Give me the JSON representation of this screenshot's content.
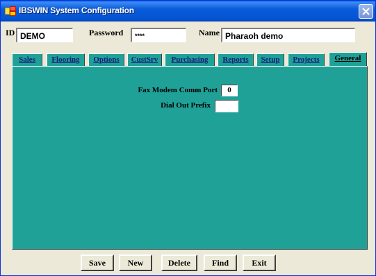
{
  "window": {
    "title": "IBSWIN System Configuration"
  },
  "header": {
    "id_label": "ID",
    "id_value": "DEMO",
    "password_label": "Password",
    "password_value": "****",
    "name_label": "Name",
    "name_value": "Pharaoh demo"
  },
  "tabs": [
    {
      "label": "Sales"
    },
    {
      "label": "Flooring"
    },
    {
      "label": "Options"
    },
    {
      "label": "CustSrv"
    },
    {
      "label": "Purchasing"
    },
    {
      "label": "Reports"
    },
    {
      "label": "Setup"
    },
    {
      "label": "Projects"
    },
    {
      "label": "General",
      "active": true
    }
  ],
  "general": {
    "fax_modem_label": "Fax Modem Comm Port",
    "fax_modem_value": "0",
    "dial_out_label": "Dial Out Prefix",
    "dial_out_value": ""
  },
  "buttons": {
    "save": "Save",
    "new": "New",
    "delete": "Delete",
    "find": "Find",
    "exit": "Exit"
  },
  "colors": {
    "panel": "#1fa198",
    "titlebar": "#0454d3"
  },
  "icons": {
    "title": "app-icon",
    "close": "close-icon"
  }
}
